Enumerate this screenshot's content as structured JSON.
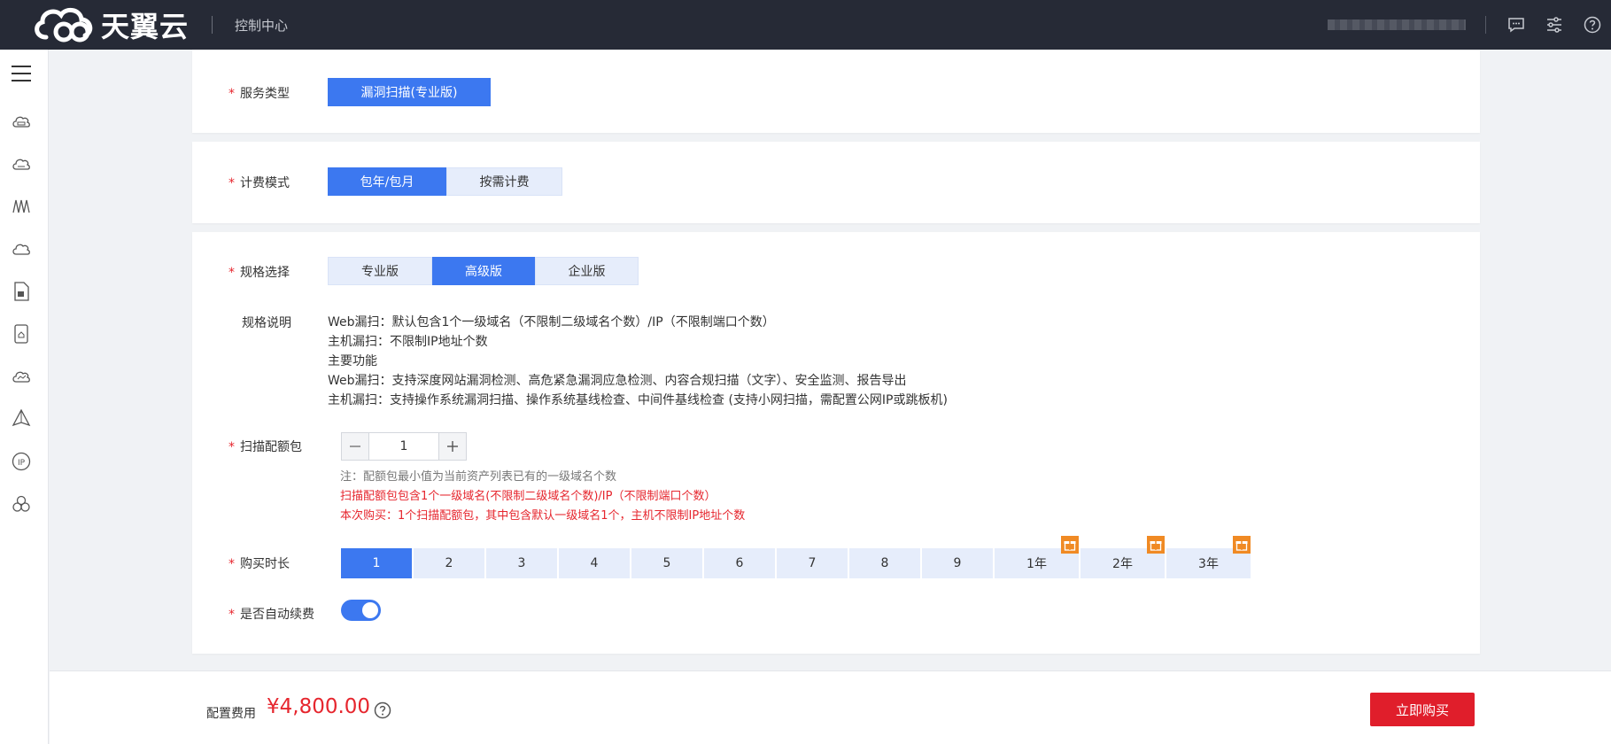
{
  "header": {
    "brand": "天翼云",
    "console_title": "控制中心",
    "icons": [
      "message-icon",
      "settings-sliders-icon",
      "help-icon"
    ]
  },
  "sidebar": {
    "icons": [
      "menu-icon",
      "cloud-server-icon",
      "cloud-host-icon",
      "network-icon",
      "cloud-storage-icon",
      "document-icon",
      "security-icon",
      "monitor-icon",
      "deploy-icon",
      "ip-icon",
      "cluster-icon"
    ]
  },
  "service_type": {
    "label": "服务类型",
    "options": [
      "漏洞扫描(专业版)"
    ],
    "selected": "漏洞扫描(专业版)"
  },
  "billing": {
    "label": "计费模式",
    "options": [
      "包年/包月",
      "按需计费"
    ],
    "selected": "包年/包月"
  },
  "spec": {
    "label": "规格选择",
    "options": [
      "专业版",
      "高级版",
      "企业版"
    ],
    "selected": "高级版",
    "desc_label": "规格说明",
    "desc_lines": [
      "Web漏扫：默认包含1个一级域名（不限制二级域名个数）/IP（不限制端口个数）",
      "主机漏扫：不限制IP地址个数",
      "主要功能",
      "Web漏扫：支持深度网站漏洞检测、高危紧急漏洞应急检测、内容合规扫描（文字）、安全监测、报告导出",
      "主机漏扫：支持操作系统漏洞扫描、操作系统基线检查、中间件基线检查 (支持小网扫描，需配置公网IP或跳板机)"
    ]
  },
  "quota": {
    "label": "扫描配额包",
    "value": "1",
    "note_gray": "注：配额包最小值为当前资产列表已有的一级域名个数",
    "note_red_1": "扫描配额包包含1个一级域名(不限制二级域名个数)/IP（不限制端口个数）",
    "note_red_2": "本次购买：1个扫描配额包，其中包含默认一级域名1个，主机不限制IP地址个数"
  },
  "duration": {
    "label": "购买时长",
    "options": [
      "1",
      "2",
      "3",
      "4",
      "5",
      "6",
      "7",
      "8",
      "9",
      "1年",
      "2年",
      "3年"
    ],
    "selected": "1",
    "gift_options": [
      "1年",
      "2年",
      "3年"
    ]
  },
  "auto_renew": {
    "label": "是否自动续费",
    "enabled": true
  },
  "footer": {
    "fee_label": "配置费用",
    "fee_value": "¥4,800.00",
    "buy_label": "立即购买"
  },
  "colors": {
    "primary": "#3c78f0",
    "danger": "#e6262e",
    "header_bg": "#262a36",
    "gift": "#f08a24"
  }
}
